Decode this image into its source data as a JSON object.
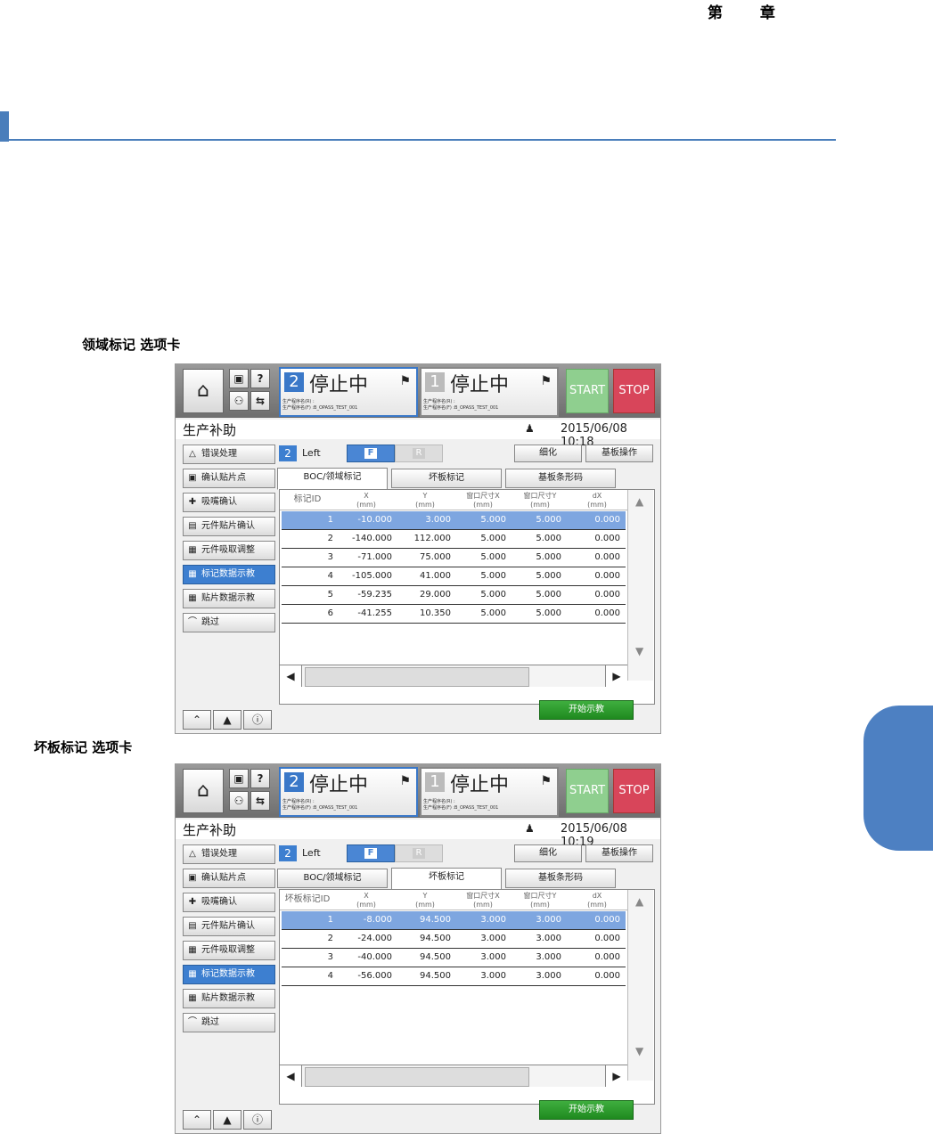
{
  "header": {
    "chapter": "第 章"
  },
  "captions": {
    "first": "领域标记 选项卡",
    "second": "坏板标记 选项卡"
  },
  "ui": {
    "home_icon": "home-icon",
    "status_left": {
      "num": "2",
      "text": "停止中",
      "prog": "生产程序名(R) :\n生产程序名(F) :B_OPASS_TEST_001"
    },
    "status_right": {
      "num": "1",
      "text": "停止中",
      "prog": "生产程序名(R) :\n生产程序名(F) :B_OPASS_TEST_001"
    },
    "start": "START",
    "stop": "STOP",
    "title": "生产补助",
    "left_menu": [
      "错误处理",
      "确认贴片点",
      "吸嘴确认",
      "元件贴片确认",
      "元件吸取调整",
      "标记数据示教",
      "贴片数据示教",
      "跳过"
    ],
    "conveyor_num": "2",
    "conveyor_label": "Left",
    "f_label": "F",
    "r_label": "R",
    "detail_btn": "细化",
    "board_op_btn": "基板操作",
    "tabs": [
      "BOC/领域标记",
      "坏板标记",
      "基板条形码"
    ],
    "teach_btn": "开始示教",
    "col_headers": {
      "x": "X",
      "y": "Y",
      "wx": "窗口尺寸X",
      "wy": "窗口尺寸Y",
      "dx": "dX",
      "unit": "(mm)"
    }
  },
  "screens": [
    {
      "datetime": "2015/06/08 10:18",
      "id_header": "标记ID",
      "rows": [
        [
          "1",
          "-10.000",
          "3.000",
          "5.000",
          "5.000",
          "0.000"
        ],
        [
          "2",
          "-140.000",
          "112.000",
          "5.000",
          "5.000",
          "0.000"
        ],
        [
          "3",
          "-71.000",
          "75.000",
          "5.000",
          "5.000",
          "0.000"
        ],
        [
          "4",
          "-105.000",
          "41.000",
          "5.000",
          "5.000",
          "0.000"
        ],
        [
          "5",
          "-59.235",
          "29.000",
          "5.000",
          "5.000",
          "0.000"
        ],
        [
          "6",
          "-41.255",
          "10.350",
          "5.000",
          "5.000",
          "0.000"
        ]
      ]
    },
    {
      "datetime": "2015/06/08 10:19",
      "id_header": "坏板标记ID",
      "rows": [
        [
          "1",
          "-8.000",
          "94.500",
          "3.000",
          "3.000",
          "0.000"
        ],
        [
          "2",
          "-24.000",
          "94.500",
          "3.000",
          "3.000",
          "0.000"
        ],
        [
          "3",
          "-40.000",
          "94.500",
          "3.000",
          "3.000",
          "0.000"
        ],
        [
          "4",
          "-56.000",
          "94.500",
          "3.000",
          "3.000",
          "0.000"
        ]
      ]
    }
  ]
}
